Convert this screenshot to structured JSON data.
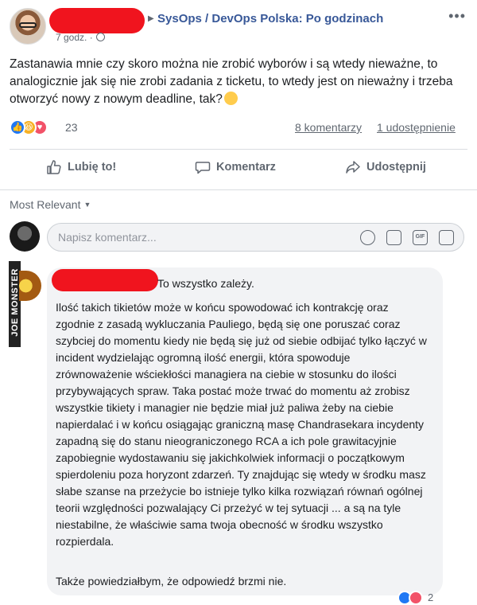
{
  "post": {
    "author_redacted": true,
    "group_name": "SysOps / DevOps Polska: Po godzinach",
    "time": "7 godz.",
    "text": "Zastanawia mnie czy skoro można nie zrobić wyborów i są wtedy nieważne, to analogicznie jak się nie zrobi zadania z ticketu, to wtedy jest on nieważny i trzeba otworzyć nowy z nowym deadline, tak?",
    "reaction_count": "23",
    "comments_link": "8 komentarzy",
    "shares_link": "1 udostępnienie"
  },
  "actions": {
    "like": "Lubię to!",
    "comment": "Komentarz",
    "share": "Udostępnij"
  },
  "sort": {
    "label": "Most Relevant"
  },
  "comment_input": {
    "placeholder": "Napisz komentarz..."
  },
  "watermark": "JOE MONSTER",
  "comment": {
    "first_line": "To wszystko zależy.",
    "paragraph": "Ilość takich tikietów może w końcu spowodować ich kontrakcję oraz zgodnie z zasadą wykluczania Pauliego, będą się one poruszać coraz szybciej do momentu kiedy nie będą się już od siebie odbijać tylko łączyć w incident wydzielając ogromną ilość energii, która spowoduje zrównoważenie wściekłości managiera na ciebie w stosunku do ilości przybywających spraw. Taka postać może trwać do momentu aż zrobisz wszystkie tikiety i managier nie będzie miał już paliwa żeby na ciebie napierdalać i w końcu osiągając graniczną masę Chandrasekara incydenty zapadną się do stanu nieograniczonego RCA a ich pole grawitacyjnie zapobiegnie wydostawaniu się jakichkolwiek informacji o początkowym spierdoleniu poza horyzont zdarzeń. Ty znajdując się wtedy w środku masz słabe szanse na przeżycie bo istnieje tylko kilka rozwiązań równań ogólnej teorii względności pozwalający Ci przeżyć w tej sytuacji ... a są na tyle niestabilne, że właściwie sama twoja obecność w środku wszystko rozpierdala.",
    "last_line": "Także powiedziałbym, że odpowiedź brzmi nie.",
    "reaction_count": "2"
  },
  "colors": {
    "link_blue": "#385898",
    "redaction": "#f0141e",
    "like_blue": "#2078f4",
    "love_red": "#f25268",
    "haha_yellow": "#f7b125"
  }
}
